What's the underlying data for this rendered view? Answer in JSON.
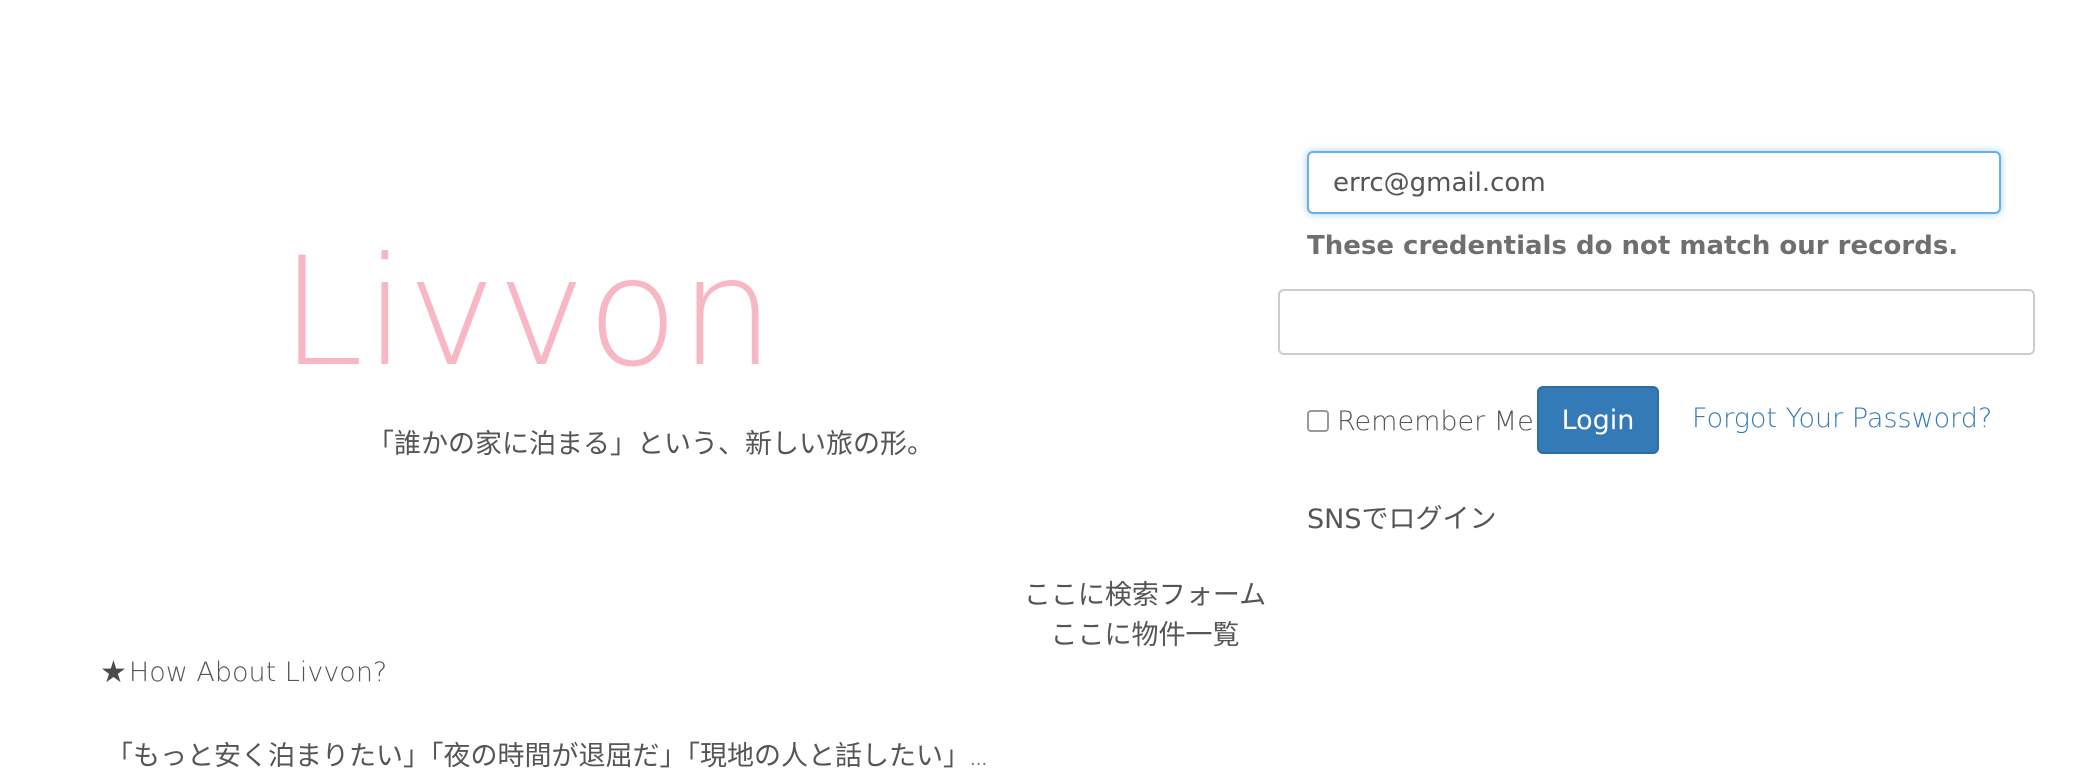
{
  "hero": {
    "title": "Livvon",
    "tagline": "「誰かの家に泊まる」という、新しい旅の形。"
  },
  "login": {
    "email_value": "errc@gmail.com",
    "error_message": "These credentials do not match our records.",
    "password_value": "",
    "remember_label": "Remember Me",
    "login_button": "Login",
    "forgot_link": "Forgot Your Password?",
    "sns_login": "SNSでログイン"
  },
  "placeholders": {
    "search_form": "ここに検索フォーム",
    "listing": "ここに物件一覧"
  },
  "about": {
    "star_icon": "star-icon",
    "heading": "How About Livvon?",
    "quotes": "「もっと安く泊まりたい」「夜の時間が退屈だ」「現地の人と話したい」",
    "ellipsis": "..."
  },
  "colors": {
    "brand_pink": "#f7b8c3",
    "primary_blue": "#337ab7",
    "focus_blue": "#66afe9"
  }
}
